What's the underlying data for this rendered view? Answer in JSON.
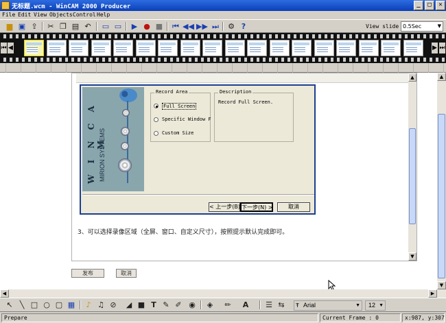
{
  "window": {
    "title": "无标题.wcm - WinCAM 2000 Producer"
  },
  "window_controls": {
    "minimize": "_",
    "maximize": "□",
    "close": "✕"
  },
  "menu": [
    "File",
    "Edit",
    "View",
    "Objects",
    "Control",
    "Help"
  ],
  "toolbar": {
    "icons": [
      "folder-open",
      "save",
      "export",
      "cut",
      "copy",
      "paste",
      "undo",
      "slide-a",
      "slide-b",
      "play",
      "record",
      "stop",
      "first",
      "previous",
      "next",
      "last",
      "properties",
      "help"
    ],
    "view_slide_label": "View slide",
    "view_slide_value": "0.5Sec"
  },
  "filmstrip": {
    "frame_count": 18,
    "selected_index": 0
  },
  "dialog": {
    "record_area_title": "Record Area",
    "options": [
      {
        "label": "Full Screen",
        "selected": true
      },
      {
        "label": "Specific Window Fra",
        "selected": false
      },
      {
        "label": "Custom Size",
        "selected": false
      }
    ],
    "description_title": "Description",
    "description_text": "Record Full Screen.",
    "back_button": "< 上一步(B)",
    "next_button": "下一步(N) >",
    "cancel_button": "取消",
    "logo_text": "W I N C A M",
    "logo_subtext": "MIRION SYSTEMS"
  },
  "instruction_text": "3、可以选择录像区域（全屏、窗口、自定义尺寸），按照提示默认完成即可。",
  "page_buttons": {
    "publish": "发布",
    "cancel": "取消"
  },
  "bottom_toolbar": {
    "font_name": "Arial",
    "font_size": "12"
  },
  "status": {
    "left": "Prepare",
    "current_frame": "Current Frame : 0",
    "coords": "x:987, y:307"
  }
}
